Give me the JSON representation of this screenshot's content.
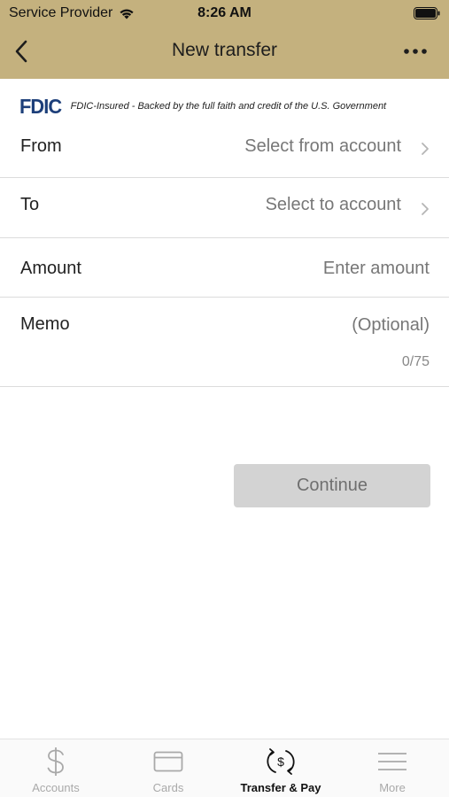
{
  "status_bar": {
    "carrier": "Service Provider",
    "time": "8:26 AM"
  },
  "nav": {
    "title": "New transfer"
  },
  "fdic": {
    "logo": "FDIC",
    "text": "FDIC-Insured - Backed by the full faith and credit of the U.S. Government"
  },
  "form": {
    "from": {
      "label": "From",
      "value": "Select from account"
    },
    "to": {
      "label": "To",
      "value": "Select to account"
    },
    "amount": {
      "label": "Amount",
      "placeholder": "Enter amount"
    },
    "memo": {
      "label": "Memo",
      "placeholder": "(Optional)",
      "counter": "0/75"
    }
  },
  "continue_label": "Continue",
  "tabs": [
    {
      "label": "Accounts",
      "icon": "dollar-icon",
      "active": false
    },
    {
      "label": "Cards",
      "icon": "card-icon",
      "active": false
    },
    {
      "label": "Transfer & Pay",
      "icon": "transfer-pay-icon",
      "active": true
    },
    {
      "label": "More",
      "icon": "menu-icon",
      "active": false
    }
  ],
  "colors": {
    "header_bg": "#c4b17e",
    "fdic_blue": "#1d3f7a",
    "button_disabled": "#d3d3d3"
  }
}
